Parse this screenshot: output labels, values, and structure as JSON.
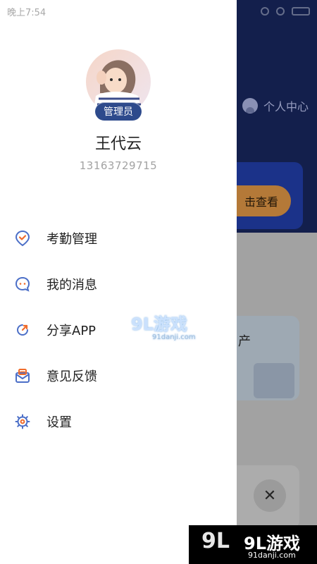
{
  "status_bar": {
    "time": "晚上7:54"
  },
  "background": {
    "personal_center": "个人中心",
    "card_button": "击查看",
    "tile_text": "产"
  },
  "profile": {
    "role": "管理员",
    "name": "王代云",
    "phone": "13163729715"
  },
  "menu": {
    "items": [
      {
        "label": "考勤管理",
        "icon": "checkin-icon"
      },
      {
        "label": "我的消息",
        "icon": "message-icon"
      },
      {
        "label": "分享APP",
        "icon": "share-icon"
      },
      {
        "label": "意见反馈",
        "icon": "feedback-icon"
      },
      {
        "label": "设置",
        "icon": "settings-icon"
      }
    ]
  },
  "watermark": {
    "center_brand": "9L游戏",
    "center_domain": "91danji.com",
    "bottom_brand": "9L游戏",
    "bottom_domain": "91danji.com"
  },
  "colors": {
    "accent": "#2d4a8c",
    "icon_blue": "#4c6fc7",
    "share_orange": "#f06b2a"
  }
}
